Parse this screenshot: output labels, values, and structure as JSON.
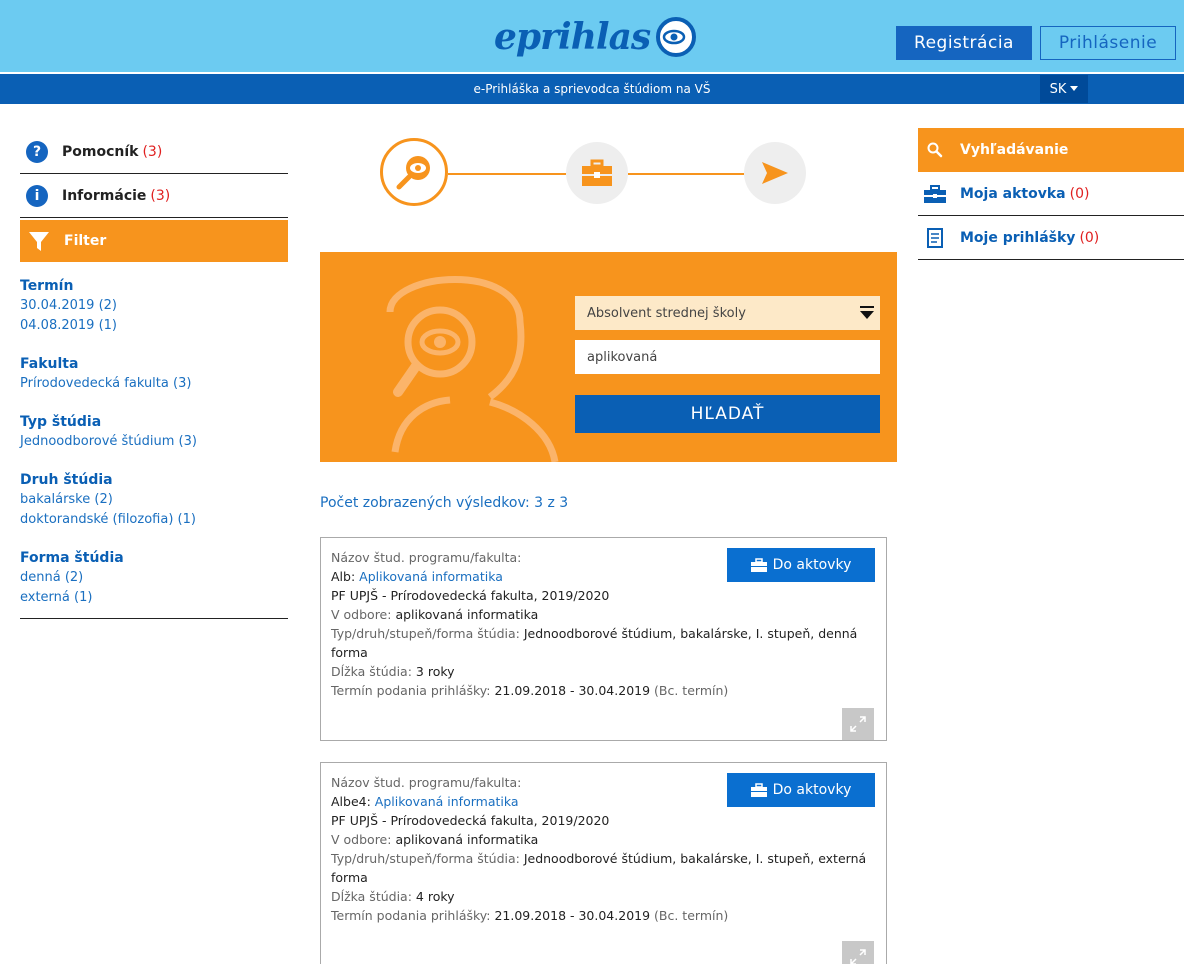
{
  "header": {
    "logo_text": "eprihlas",
    "register_label": "Registrácia",
    "login_label": "Prihlásenie",
    "subtitle": "e-Prihláška a sprievodca štúdiom na VŠ",
    "language": "SK"
  },
  "left_sidebar": {
    "helper": {
      "label": "Pomocník",
      "count": "(3)"
    },
    "info": {
      "label": "Informácie",
      "count": "(3)"
    },
    "filter_label": "Filter",
    "groups": [
      {
        "title": "Termín",
        "items": [
          "30.04.2019  (2)",
          "04.08.2019  (1)"
        ]
      },
      {
        "title": "Fakulta",
        "items": [
          "Prírodovedecká fakulta  (3)"
        ]
      },
      {
        "title": "Typ štúdia",
        "items": [
          "Jednoodborové štúdium  (3)"
        ]
      },
      {
        "title": "Druh štúdia",
        "items": [
          "bakalárske  (2)",
          "doktorandské (filozofia)  (1)"
        ]
      },
      {
        "title": "Forma štúdia",
        "items": [
          "denná  (2)",
          "externá  (1)"
        ]
      }
    ]
  },
  "search": {
    "applicant_type": "Absolvent strednej školy",
    "query": "aplikovaná",
    "button_label": "HĽADAŤ"
  },
  "results_label": "Počet zobrazených výsledkov: 3 z 3",
  "results": [
    {
      "program_label": "Názov štud. programu/fakulta:",
      "program_code": "Alb: ",
      "program_name": "Aplikovaná informatika",
      "faculty": "PF UPJŠ - Prírodovedecká fakulta, 2019/2020",
      "field_label": "V odbore: ",
      "field_value": "aplikovaná informatika",
      "type_label": "Typ/druh/stupeň/forma štúdia: ",
      "type_value": "Jednoodborové štúdium, bakalárske, I. stupeň, denná forma",
      "length_label": "Dĺžka štúdia: ",
      "length_value": "3 roky",
      "deadline_label": "Termín podania prihlášky: ",
      "deadline_value": "21.09.2018 - 30.04.2019",
      "deadline_note": " (Bc. termín)",
      "add_label": "Do aktovky"
    },
    {
      "program_label": "Názov štud. programu/fakulta:",
      "program_code": "Albe4: ",
      "program_name": "Aplikovaná informatika",
      "faculty": "PF UPJŠ - Prírodovedecká fakulta, 2019/2020",
      "field_label": "V odbore: ",
      "field_value": "aplikovaná informatika",
      "type_label": "Typ/druh/stupeň/forma štúdia: ",
      "type_value": "Jednoodborové štúdium, bakalárske, I. stupeň, externá forma",
      "length_label": "Dĺžka štúdia: ",
      "length_value": "4 roky",
      "deadline_label": "Termín podania prihlášky: ",
      "deadline_value": "21.09.2018 - 30.04.2019",
      "deadline_note": " (Bc. termín)",
      "add_label": "Do aktovky"
    }
  ],
  "right_sidebar": {
    "search_label": "Vyhľadávanie",
    "briefcase": {
      "label": "Moja aktovka",
      "count": "(0)"
    },
    "applications": {
      "label": "Moje prihlášky",
      "count": "(0)"
    }
  },
  "colors": {
    "header_bg": "#6ccbf1",
    "brand_blue": "#0a5fb4",
    "accent_orange": "#f7941d",
    "count_red": "#e02020"
  },
  "icons": [
    "eye-logo-icon",
    "question-icon",
    "info-icon",
    "filter-icon",
    "search-eye-icon",
    "briefcase-icon",
    "send-arrow-icon",
    "chevron-down-icon",
    "expand-icon",
    "document-icon",
    "magnifier-icon"
  ]
}
